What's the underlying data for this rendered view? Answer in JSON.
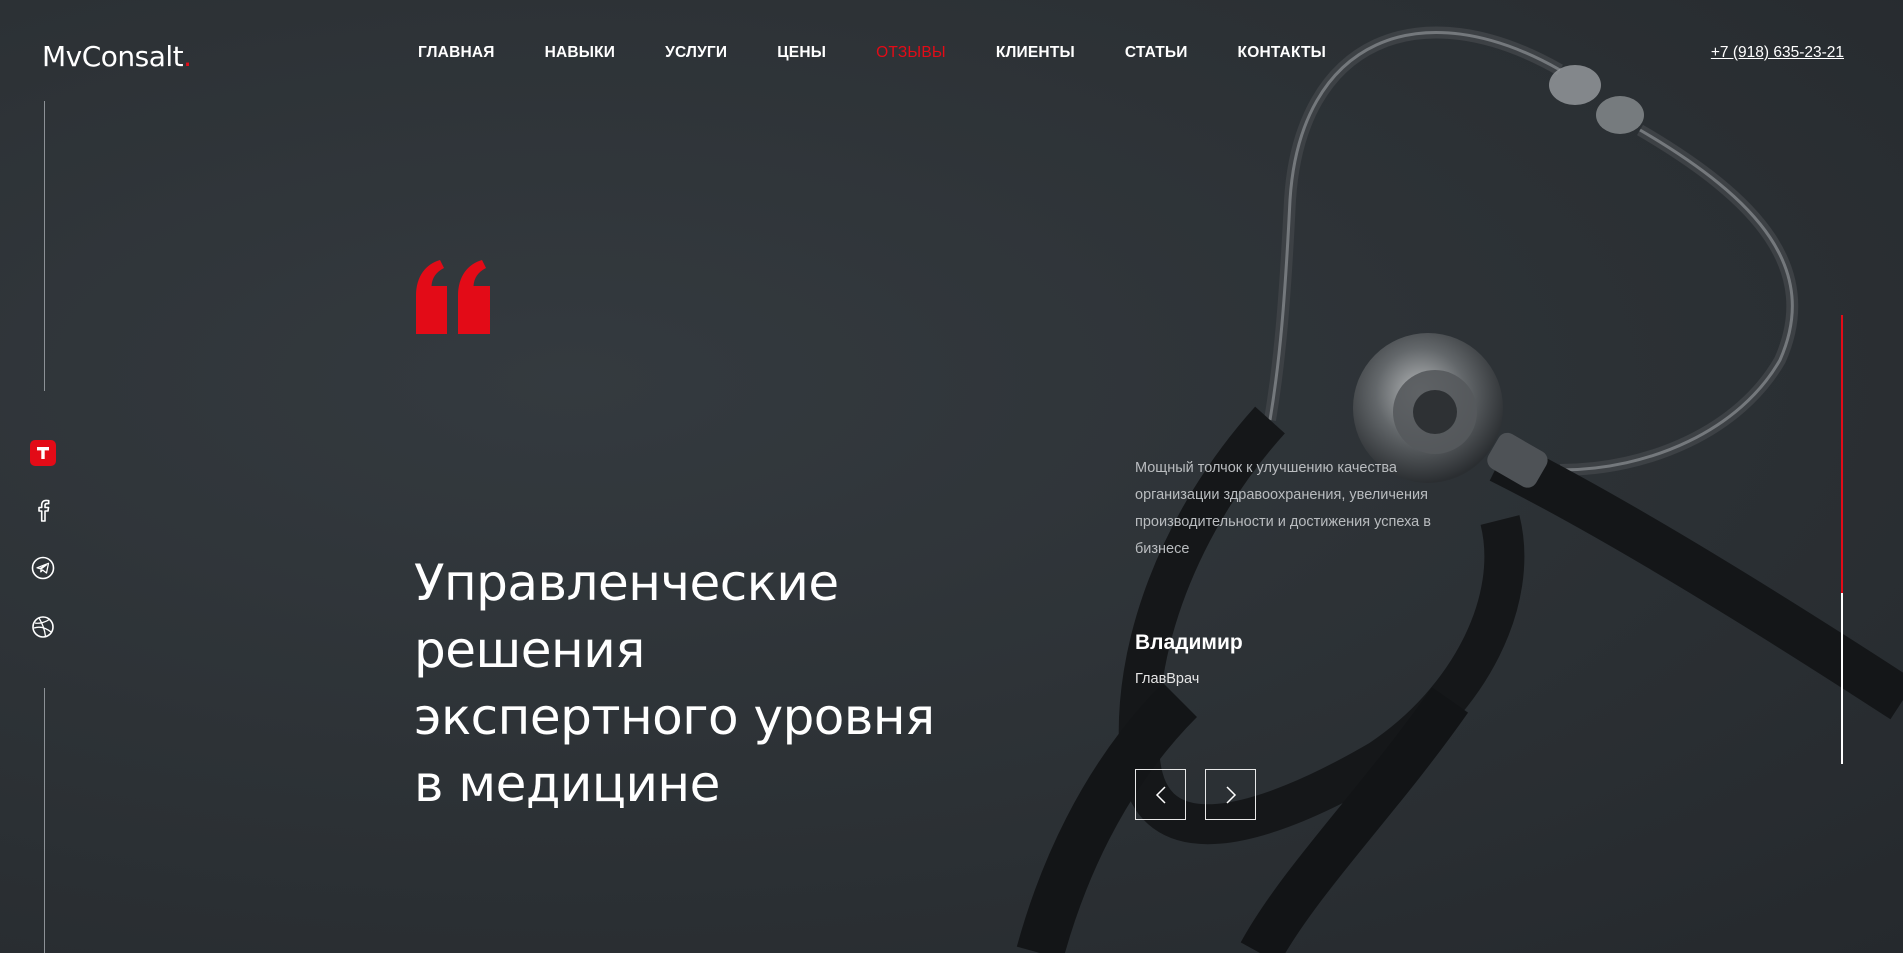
{
  "brand": {
    "logo_text": "MvConsalt",
    "logo_dot": ".",
    "accent_color": "#e30b17"
  },
  "nav": {
    "items": [
      {
        "label": "ГЛАВНАЯ"
      },
      {
        "label": "НАВЫКИ"
      },
      {
        "label": "УСЛУГИ"
      },
      {
        "label": "ЦЕНЫ"
      },
      {
        "label": "ОТЗЫВЫ",
        "active": true
      },
      {
        "label": "КЛИЕНТЫ"
      },
      {
        "label": "СТАТЬИ"
      },
      {
        "label": "КОНТАКТЫ"
      }
    ]
  },
  "header": {
    "phone": "+7 (918) 635-23-21"
  },
  "social": {
    "icons": [
      "tinkoff-icon",
      "facebook-icon",
      "telegram-icon",
      "dribbble-icon"
    ]
  },
  "hero": {
    "headline_lines": [
      "Управленческие",
      "решения",
      "экспертного уровня",
      "в медицине"
    ]
  },
  "review": {
    "text": "Мощный толчок к улучшению качества организации здравоохранения, увеличения производительности и достижения успеха в бизнесе",
    "author_name": "Владимир",
    "author_role": "ГлавВрач"
  },
  "slider": {
    "progress": 0.62
  }
}
